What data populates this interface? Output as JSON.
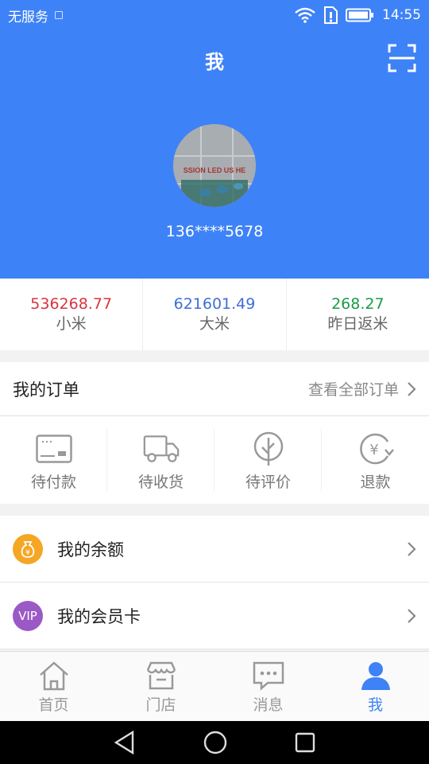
{
  "status_bar": {
    "carrier": "无服务",
    "time": "14:55"
  },
  "header": {
    "title": "我",
    "avatar_text": "SSION LED US HE",
    "phone": "136****5678"
  },
  "stats": [
    {
      "value": "536268.77",
      "label": "小米",
      "color": "#d9343f"
    },
    {
      "value": "621601.49",
      "label": "大米",
      "color": "#3e6fd6"
    },
    {
      "value": "268.27",
      "label": "昨日返米",
      "color": "#1a9b49"
    }
  ],
  "orders": {
    "title": "我的订单",
    "view_all": "查看全部订单",
    "items": [
      {
        "label": "待付款",
        "icon": "wallet-icon"
      },
      {
        "label": "待收货",
        "icon": "truck-icon"
      },
      {
        "label": "待评价",
        "icon": "tree-icon"
      },
      {
        "label": "退款",
        "icon": "refund-icon"
      }
    ]
  },
  "menu": [
    {
      "label": "我的余额",
      "icon": "money-bag-icon",
      "color": "#f5a623",
      "glyph": "¥"
    },
    {
      "label": "我的会员卡",
      "icon": "vip-icon",
      "color": "#9b59c6",
      "glyph": "VIP"
    }
  ],
  "tabs": [
    {
      "label": "首页",
      "icon": "home-icon",
      "active": false
    },
    {
      "label": "门店",
      "icon": "store-icon",
      "active": false
    },
    {
      "label": "消息",
      "icon": "message-icon",
      "active": false
    },
    {
      "label": "我",
      "icon": "user-icon",
      "active": true
    }
  ],
  "colors": {
    "primary": "#3e82f7",
    "inactive": "#999999"
  }
}
